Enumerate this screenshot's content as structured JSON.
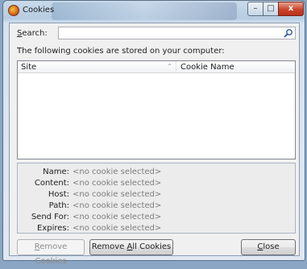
{
  "window": {
    "title": "Cookies",
    "minimize_glyph": "–",
    "maximize_glyph": "□",
    "close_glyph": "x"
  },
  "search": {
    "label": "Search:",
    "label_underline_char": "S",
    "label_rest": "earch:",
    "value": "",
    "placeholder": ""
  },
  "info_text": "The following cookies are stored on your computer:",
  "list": {
    "columns": [
      "Site",
      "Cookie Name"
    ],
    "sort_indicator": "^",
    "rows": []
  },
  "details": [
    {
      "label": "Name:",
      "value": "<no cookie selected>"
    },
    {
      "label": "Content:",
      "value": "<no cookie selected>"
    },
    {
      "label": "Host:",
      "value": "<no cookie selected>"
    },
    {
      "label": "Path:",
      "value": "<no cookie selected>"
    },
    {
      "label": "Send For:",
      "value": "<no cookie selected>"
    },
    {
      "label": "Expires:",
      "value": "<no cookie selected>"
    }
  ],
  "buttons": {
    "remove_cookies": {
      "accel": "R",
      "rest": "emove Cookies",
      "enabled": false
    },
    "remove_all_cookies": {
      "pre": "Remove ",
      "accel": "A",
      "rest": "ll Cookies",
      "enabled": true
    },
    "close": {
      "accel": "C",
      "rest": "lose",
      "enabled": true
    }
  },
  "colors": {
    "title_bar": "#b6cce2",
    "close_button": "#c9442a",
    "disabled_text": "#8d8d8d"
  },
  "icons": {
    "app": "firefox-icon",
    "search": "magnifier-icon",
    "sort": "sort-ascending-icon"
  }
}
